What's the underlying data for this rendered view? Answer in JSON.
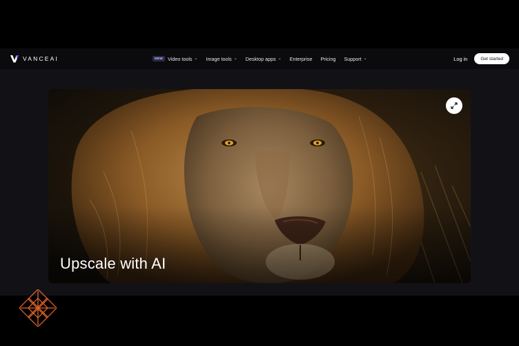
{
  "brand": {
    "name": "VANCEAI",
    "logo_icon": "vanceai-v-logo",
    "accent_color": "#4c57ff"
  },
  "nav": {
    "items": [
      {
        "label": "Video tools",
        "badge": "NEW",
        "has_dropdown": true
      },
      {
        "label": "Image tools",
        "has_dropdown": true
      },
      {
        "label": "Desktop apps",
        "has_dropdown": true
      },
      {
        "label": "Enterprise",
        "has_dropdown": false
      },
      {
        "label": "Pricing",
        "has_dropdown": false
      },
      {
        "label": "Support",
        "has_dropdown": true
      }
    ],
    "login_label": "Log in",
    "cta_label": "Get started"
  },
  "hero": {
    "title": "Upscale with AI",
    "image_subject": "lion",
    "expand_icon": "expand-arrows-icon"
  },
  "watermark": {
    "icon": "orange-lattice-flower-icon",
    "color": "#e0622a"
  }
}
